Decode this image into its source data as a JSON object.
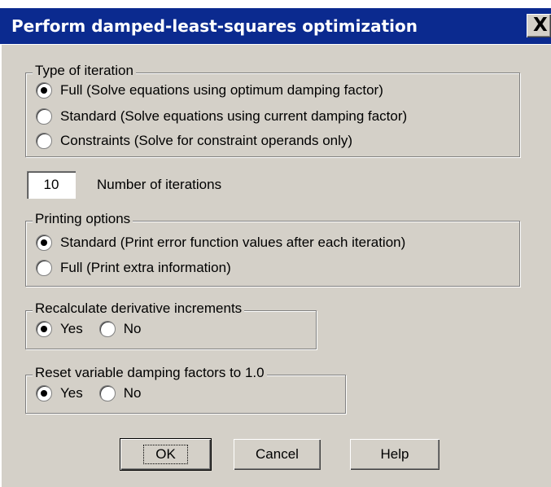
{
  "window": {
    "title": "Perform damped-least-squares optimization",
    "close_label": "X"
  },
  "iteration_type": {
    "legend": "Type of iteration",
    "options": [
      {
        "label": "Full  (Solve equations using optimum damping factor)",
        "selected": true
      },
      {
        "label": "Standard  (Solve equations using current damping factor)",
        "selected": false
      },
      {
        "label": "Constraints  (Solve for constraint operands only)",
        "selected": false
      }
    ]
  },
  "iterations": {
    "value": "10",
    "label": "Number of iterations"
  },
  "printing": {
    "legend": "Printing options",
    "options": [
      {
        "label": "Standard  (Print error function values after each iteration)",
        "selected": true
      },
      {
        "label": "Full  (Print extra information)",
        "selected": false
      }
    ]
  },
  "recalc": {
    "legend": "Recalculate derivative increments",
    "yes": "Yes",
    "no": "No",
    "selected": "Yes"
  },
  "reset": {
    "legend": "Reset variable damping factors to 1.0",
    "yes": "Yes",
    "no": "No",
    "selected": "Yes"
  },
  "buttons": {
    "ok": "OK",
    "cancel": "Cancel",
    "help": "Help"
  }
}
